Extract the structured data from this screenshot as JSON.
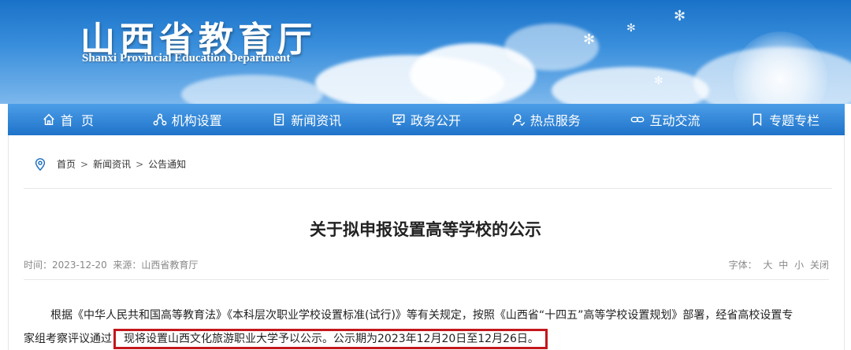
{
  "header": {
    "title_cn": "山西省教育厅",
    "title_en": "Shanxi Provincial Education Department"
  },
  "nav": {
    "items": [
      {
        "label": "首  页",
        "icon": "home-icon"
      },
      {
        "label": "机构设置",
        "icon": "organization-icon"
      },
      {
        "label": "新闻资讯",
        "icon": "document-icon"
      },
      {
        "label": "政务公开",
        "icon": "monitor-icon"
      },
      {
        "label": "热点服务",
        "icon": "user-service-icon"
      },
      {
        "label": "互动交流",
        "icon": "link-icon"
      },
      {
        "label": "专题专栏",
        "icon": "bookmark-icon"
      }
    ]
  },
  "breadcrumb": {
    "icon": "location-pin-icon",
    "items": [
      "首页",
      "新闻资讯",
      "公告通知"
    ],
    "separator": ">"
  },
  "article": {
    "title": "关于拟申报设置高等学校的公示",
    "meta_left": "时间：2023-12-20  来源：山西省教育厅",
    "font_label": "字体：",
    "font_large": "大",
    "font_medium": "中",
    "font_small": "小",
    "close": "关闭",
    "para_line1": "根据《中华人民共和国高等教育法》《本科层次职业学校设置标准(试行)》等有关规定，按照《山西省“十四五”高等学校设置规划》部署，经省高校设置专",
    "para_line2_start": "家组考察评议通过",
    "para_highlight": "现将设置山西文化旅游职业大学予以公示。公示期为2023年12月20日至12月26日。"
  },
  "colors": {
    "nav_top": "#4c9ee8",
    "nav_bottom": "#1f73c9",
    "highlight_border": "#c4161c"
  }
}
